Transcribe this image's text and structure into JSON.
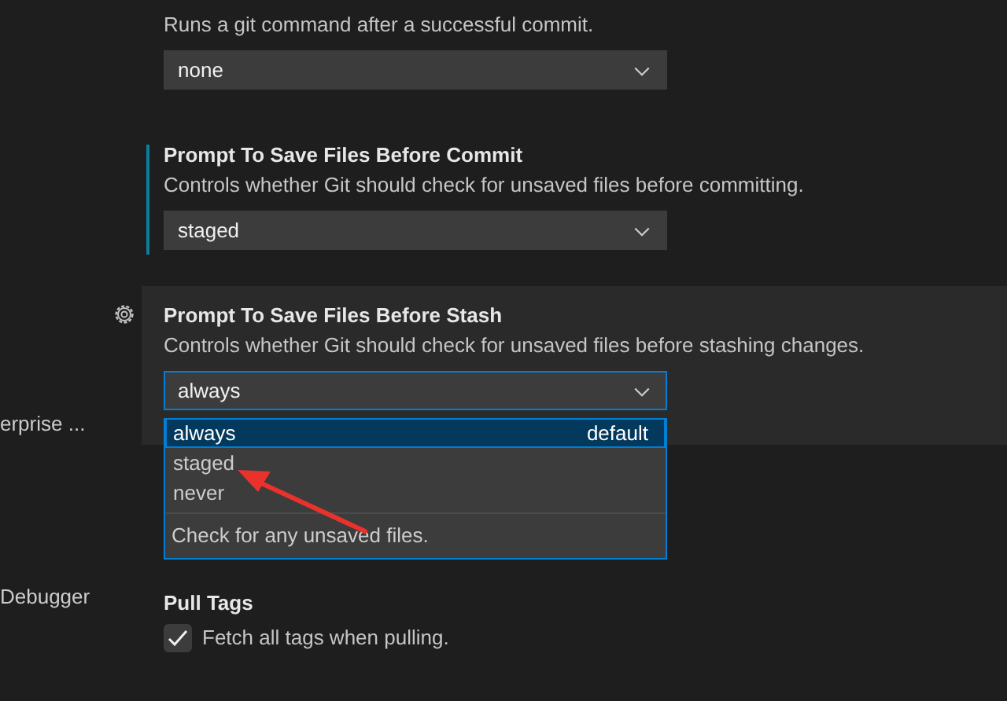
{
  "sidebar": {
    "items": [
      {
        "label": "erprise ..."
      },
      {
        "label": "Debugger"
      }
    ]
  },
  "settings": [
    {
      "kind": "select",
      "description": "Runs a git command after a successful commit.",
      "value": "none",
      "modified": false,
      "focused": false
    },
    {
      "kind": "select",
      "title": "Prompt To Save Files Before Commit",
      "description": "Controls whether Git should check for unsaved files before committing.",
      "value": "staged",
      "modified": true,
      "focused": false
    },
    {
      "kind": "select",
      "title": "Prompt To Save Files Before Stash",
      "description": "Controls whether Git should check for unsaved files before stashing changes.",
      "value": "always",
      "modified": false,
      "focused": true,
      "dropdown": {
        "options": [
          {
            "label": "always",
            "badge": "default",
            "selected": true
          },
          {
            "label": "staged",
            "selected": false
          },
          {
            "label": "never",
            "selected": false
          }
        ],
        "description": "Check for any unsaved files."
      }
    },
    {
      "kind": "checkbox",
      "title": "Pull Tags",
      "description": "Fetch all tags when pulling.",
      "checked": true,
      "modified": false,
      "focused": false
    }
  ]
}
